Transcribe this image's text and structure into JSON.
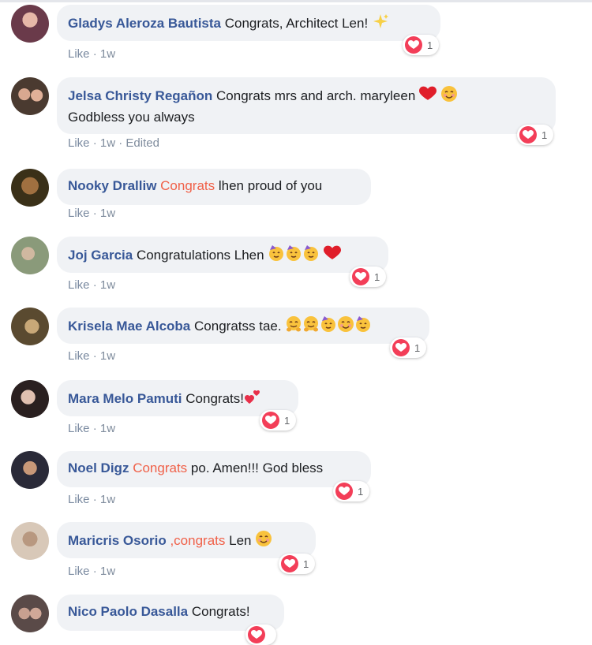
{
  "comments": [
    {
      "author": "Gladys Aleroza Bautista",
      "text": "Congrats, Architect Len!",
      "like": "Like",
      "time": "1w",
      "reactions": "1",
      "avatar_color": "#8a4a6a"
    },
    {
      "author": "Jelsa Christy Regañon",
      "text": "Congrats mrs and arch. maryleen",
      "text2": "Godbless you always",
      "like": "Like",
      "time": "1w",
      "edited": "Edited",
      "reactions": "1",
      "avatar_color": "#6a5a4a"
    },
    {
      "author": "Nooky Dralliw",
      "tag": "Congrats",
      "text": "lhen proud of you",
      "like": "Like",
      "time": "1w",
      "avatar_color": "#5a4a2a"
    },
    {
      "author": "Joj Garcia",
      "text": "Congratulations Lhen",
      "like": "Like",
      "time": "1w",
      "reactions": "1",
      "avatar_color": "#7a8a6a"
    },
    {
      "author": "Krisela Mae Alcoba",
      "text": "Congratss tae.",
      "like": "Like",
      "time": "1w",
      "reactions": "1",
      "avatar_color": "#8a7a5a"
    },
    {
      "author": "Mara Melo Pamuti",
      "text": "Congrats!",
      "like": "Like",
      "time": "1w",
      "reactions": "1",
      "avatar_color": "#4a3a3a"
    },
    {
      "author": "Noel Digz",
      "tag": "Congrats",
      "text": "po. Amen!!! God bless",
      "like": "Like",
      "time": "1w",
      "reactions": "1",
      "avatar_color": "#3a3a4a"
    },
    {
      "author": "Maricris Osorio",
      "tag": ",congrats",
      "text": "Len",
      "like": "Like",
      "time": "1w",
      "reactions": "1",
      "avatar_color": "#c8b8a8"
    },
    {
      "author": "Nico Paolo Dasalla",
      "text": "Congrats!",
      "avatar_color": "#6a5a5a"
    }
  ],
  "colors": {
    "author": "#385898",
    "tag": "#f06048",
    "heart": "#f33e58",
    "bubble": "#f0f2f5",
    "meta": "#7f8c9d"
  },
  "icons": {
    "reaction": "love-heart-icon",
    "sparkles": "sparkles-emoji",
    "heart": "red-heart-emoji",
    "smile": "smiling-face-emoji",
    "party": "partying-face-emoji",
    "hugging": "hugging-face-emoji",
    "two-hearts": "two-hearts-emoji"
  }
}
